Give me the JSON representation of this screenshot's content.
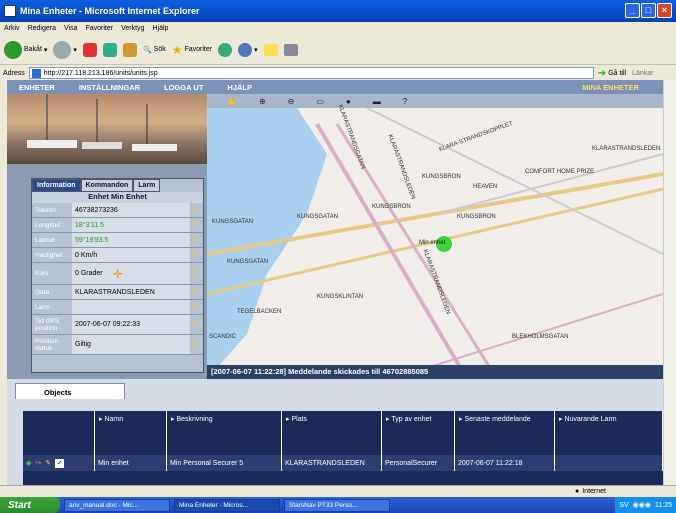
{
  "window": {
    "title": "Mina Enheter - Microsoft Internet Explorer"
  },
  "menu": [
    "Arkiv",
    "Redigera",
    "Visa",
    "Favoriter",
    "Verktyg",
    "Hjälp"
  ],
  "toolbar": {
    "back": "Bakåt",
    "search": "Sök",
    "favorites": "Favoriter"
  },
  "address": {
    "label": "Adress",
    "url": "http://217.118.213.186/units/units.jsp",
    "go": "Gå till",
    "links": "Länkar"
  },
  "nav": {
    "items": [
      "ENHETER",
      "INSTÄLLNINGAR",
      "LOGGA UT",
      "HJÄLP"
    ],
    "right": "MINA ENHETER"
  },
  "info": {
    "tabs": [
      "Information",
      "Kommandon",
      "Larm"
    ],
    "title": "Enhet Min Enhet",
    "rows": [
      {
        "k": "Telefon :",
        "v": "46738273236"
      },
      {
        "k": "Longitud :",
        "v": "18°3'11.5"
      },
      {
        "k": "Latitud :",
        "v": "59°19'93.5"
      },
      {
        "k": "Hastighet :",
        "v": "0 Km/h"
      },
      {
        "k": "Kurs :",
        "v": "0 Grader"
      },
      {
        "k": "Gata :",
        "v": "KLARASTRANDSLEDEN"
      },
      {
        "k": "Larm :",
        "v": ""
      },
      {
        "k": "Tid GPS position :",
        "v": "2007-06-07 09:22:33"
      },
      {
        "k": "Position status :",
        "v": "Giltig"
      }
    ]
  },
  "map": {
    "labels": [
      "KLARASTRANDSLEDEN",
      "KLARASTRANDSLEDEN",
      "KLARASTRANDSLEDEN",
      "KLARASTRANDSGATAN",
      "KLARA-STRANDSKOPPLET",
      "KUNGSBRON",
      "COMFORT HOME PRIZE",
      "HEAVEN",
      "KUNGSGATAN",
      "KUNGSGATAN",
      "KUNGSGATAN",
      "KUNGSBRON",
      "SCANDIC",
      "Min enhet",
      "KUNGSKLINTAN",
      "BLEKHOLMSGATAN",
      "TEGELBACKEN",
      "KUNGSBRON"
    ],
    "unit_label": "Min enhet"
  },
  "status_msg": "[2007-06-07 11:22:28] Meddelande skickades till 46702885085",
  "objects": {
    "tab": "Objects",
    "headers": [
      "Namn",
      "Beskrivning",
      "Plats",
      "Typ av enhet",
      "Senaste meddelande",
      "Nuvarande Larm"
    ],
    "row": {
      "namn": "Min enhet",
      "beskrivning": "Min Personal Securer 5",
      "plats": "KLARASTRANDSLEDEN",
      "typ": "PersonalSecurer",
      "senaste": "2007-06-07 11:22:18",
      "larm": ""
    }
  },
  "statusbar": {
    "zone": "Internet"
  },
  "taskbar": {
    "start": "Start",
    "tasks": [
      "anv_manual.doc - Mic...",
      "Mina Enheter - Micros...",
      "StarsNav PT33 Perso..."
    ],
    "lang": "SV",
    "time": "11:25"
  }
}
